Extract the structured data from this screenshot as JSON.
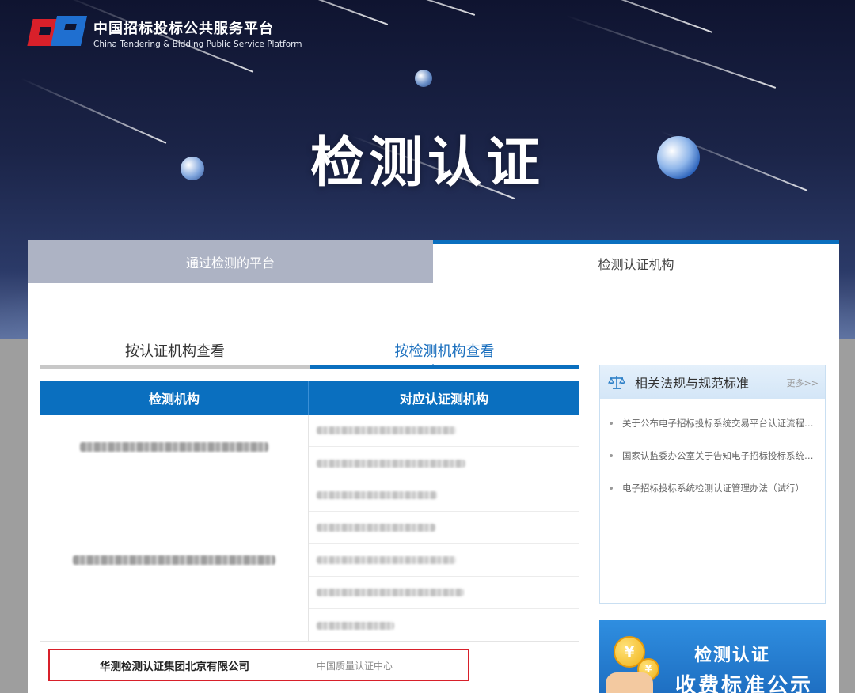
{
  "header": {
    "logo_cn": "中国招标投标公共服务平台",
    "logo_en": "China Tendering & Bidding Public Service Platform",
    "hero_title": "检测认证"
  },
  "tabs": [
    {
      "label": "通过检测的平台",
      "active": false
    },
    {
      "label": "检测认证机构",
      "active": true
    }
  ],
  "subtabs": [
    {
      "label": "按认证机构查看",
      "active": false
    },
    {
      "label": "按检测机构查看",
      "active": true
    }
  ],
  "table": {
    "headers": [
      "检测机构",
      "对应认证测机构"
    ],
    "highlight_row": {
      "left": "华测检测认证集团北京有限公司",
      "right": "中国质量认证中心"
    }
  },
  "sidebar": {
    "title": "相关法规与规范标准",
    "more": "更多>>",
    "items": [
      "关于公布电子招标投标系统交易平台认证流程的公告",
      "国家认监委办公室关于告知电子招标投标系统检测认证",
      "电子招标投标系统检测认证管理办法（试行）"
    ]
  },
  "banner": {
    "line1": "检测认证",
    "line2": "收费标准公示"
  },
  "colors": {
    "accent": "#0a6fbf",
    "highlight_border": "#d8202a"
  }
}
